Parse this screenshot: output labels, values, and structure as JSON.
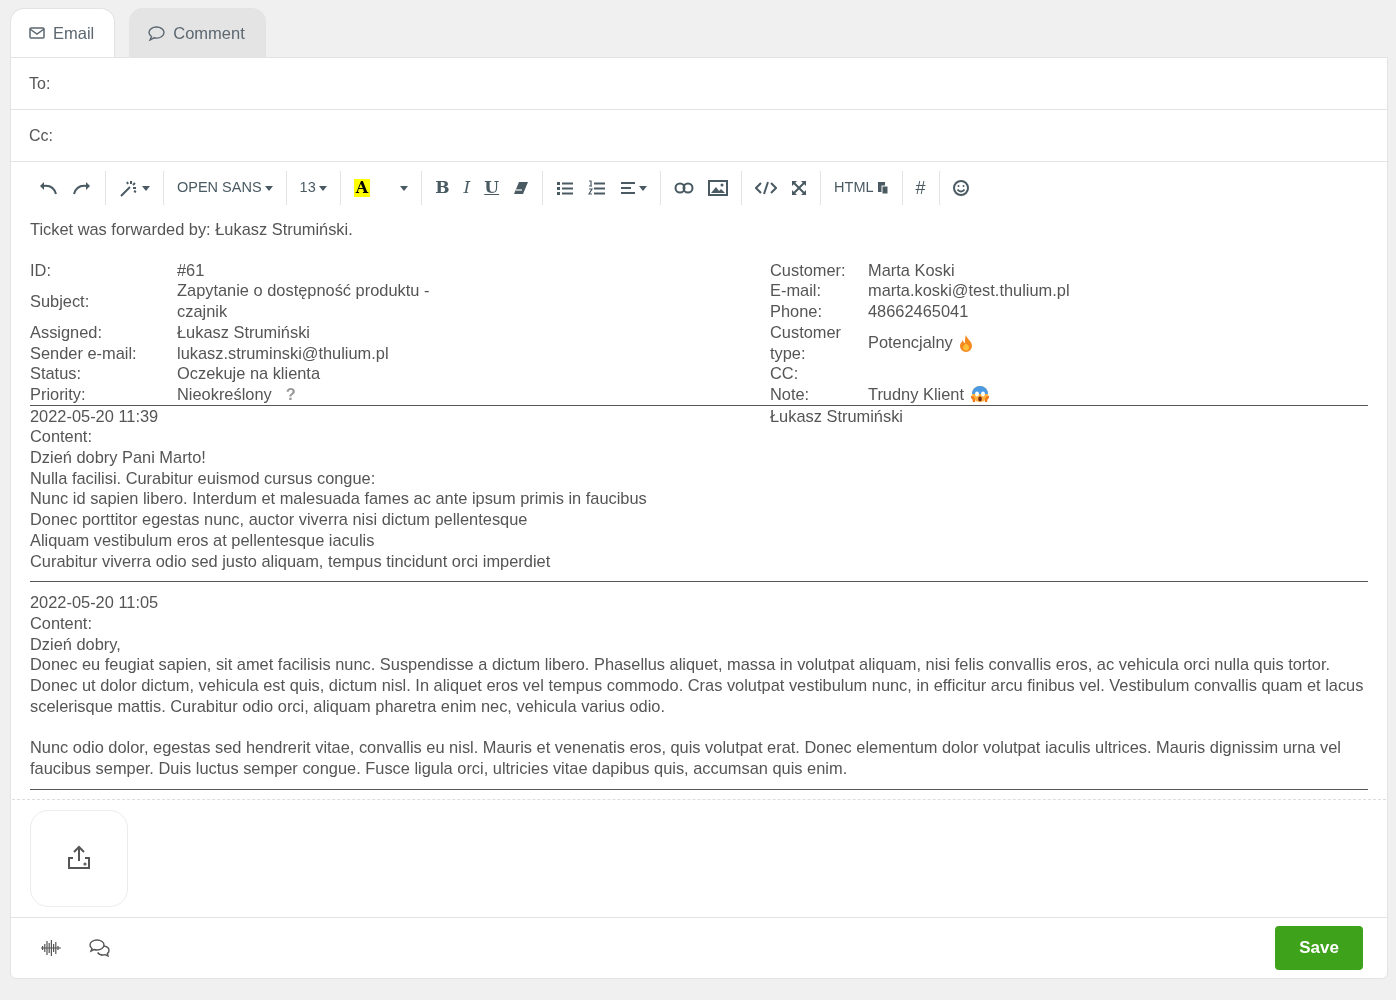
{
  "tabs": [
    {
      "label": "Email",
      "kind": "email",
      "selected": true
    },
    {
      "label": "Comment",
      "kind": "comment",
      "selected": false
    }
  ],
  "recipients": [
    {
      "label": "To:"
    },
    {
      "label": "Cc:"
    }
  ],
  "toolbar": [
    {
      "items": [
        {
          "kind": "undo"
        },
        {
          "kind": "redo"
        }
      ]
    },
    {
      "items": [
        {
          "kind": "magic"
        }
      ]
    },
    {
      "items": [
        {
          "kind": "font",
          "label": "OPEN SANS"
        }
      ]
    },
    {
      "items": [
        {
          "kind": "size",
          "label": "13"
        }
      ]
    },
    {
      "items": [
        {
          "kind": "color",
          "label": "A"
        },
        {
          "kind": "caret"
        }
      ]
    },
    {
      "items": [
        {
          "kind": "bold",
          "label": "B"
        },
        {
          "kind": "italic",
          "label": "I"
        },
        {
          "kind": "underline",
          "label": "U"
        },
        {
          "kind": "eraser"
        }
      ]
    },
    {
      "items": [
        {
          "kind": "bullets"
        },
        {
          "kind": "numbers"
        },
        {
          "kind": "align"
        }
      ]
    },
    {
      "items": [
        {
          "kind": "link"
        },
        {
          "kind": "image"
        }
      ]
    },
    {
      "items": [
        {
          "kind": "code"
        },
        {
          "kind": "fullscreen"
        }
      ]
    },
    {
      "items": [
        {
          "kind": "html",
          "label": "HTML"
        }
      ]
    },
    {
      "items": [
        {
          "kind": "hash",
          "label": "#"
        }
      ]
    },
    {
      "items": [
        {
          "kind": "emoji"
        }
      ]
    }
  ],
  "forwarded": "Ticket was forwarded by: Łukasz Strumiński.",
  "info_left": [
    {
      "label": "ID:",
      "value": "#61",
      "kind": "plain"
    },
    {
      "label": "Subject:",
      "value": "Zapytanie o dostępność produktu - czajnik",
      "kind": "plain"
    },
    {
      "label": "Assigned:",
      "value": "Łukasz Strumiński",
      "kind": "plain"
    },
    {
      "label": "Sender e-mail:",
      "value": "lukasz.struminski@thulium.pl",
      "kind": "plain"
    },
    {
      "label": "Status:",
      "value": "Oczekuje na klienta",
      "kind": "plain"
    },
    {
      "label": "Priority:",
      "value": "Nieokreślony",
      "hint": "?",
      "kind": "hint"
    }
  ],
  "info_right": [
    {
      "label": "Customer:",
      "value": "Marta Koski",
      "kind": "plain"
    },
    {
      "label": "E-mail:",
      "value": "marta.koski@test.thulium.pl",
      "kind": "plain"
    },
    {
      "label": "Phone:",
      "value": "48662465041",
      "kind": "plain"
    },
    {
      "label": "Customer type:",
      "value": "Potencjalny",
      "kind": "flame"
    },
    {
      "label": "CC:",
      "kind": "plain"
    },
    {
      "label": "Note:",
      "value": "Trudny Klient",
      "kind": "scared"
    }
  ],
  "messages": [
    {
      "date": "2022-05-20 11:39",
      "author": "Łukasz Strumiński",
      "content_label": "Content:",
      "paragraphs": [
        [
          "Dzień dobry Pani Marto!",
          "Nulla facilisi. Curabitur euismod cursus congue:",
          "Nunc id sapien libero. Interdum et malesuada fames ac ante ipsum primis in faucibus",
          "Donec porttitor egestas nunc, auctor viverra nisi dictum pellentesque",
          "Aliquam vestibulum eros at pellentesque iaculis",
          "Curabitur viverra odio sed justo aliquam, tempus tincidunt orci imperdiet"
        ]
      ]
    },
    {
      "date": "2022-05-20 11:05",
      "content_label": "Content:",
      "paragraphs": [
        [
          "Dzień dobry,",
          "Donec eu feugiat sapien, sit amet facilisis nunc. Suspendisse a dictum libero. Phasellus aliquet, massa in volutpat aliquam, nisi felis convallis eros, ac vehicula orci nulla quis tortor. Donec ut dolor dictum, vehicula est quis, dictum nisl. In aliquet eros vel tempus commodo. Cras volutpat vestibulum nunc, in efficitur arcu finibus vel. Vestibulum convallis quam et lacus scelerisque mattis. Curabitur odio orci, aliquam pharetra enim nec, vehicula varius odio."
        ],
        [
          "Nunc odio dolor, egestas sed hendrerit vitae, convallis eu nisl. Mauris et venenatis eros, quis volutpat erat. Donec elementum dolor volutpat iaculis ultrices. Mauris dignissim urna vel faucibus semper. Duis luctus semper congue. Fusce ligula orci, ultricies vitae dapibus quis, accumsan quis enim."
        ]
      ]
    }
  ],
  "footer": {
    "tools": [
      {
        "kind": "voice"
      },
      {
        "kind": "chat"
      }
    ],
    "save": "Save"
  }
}
